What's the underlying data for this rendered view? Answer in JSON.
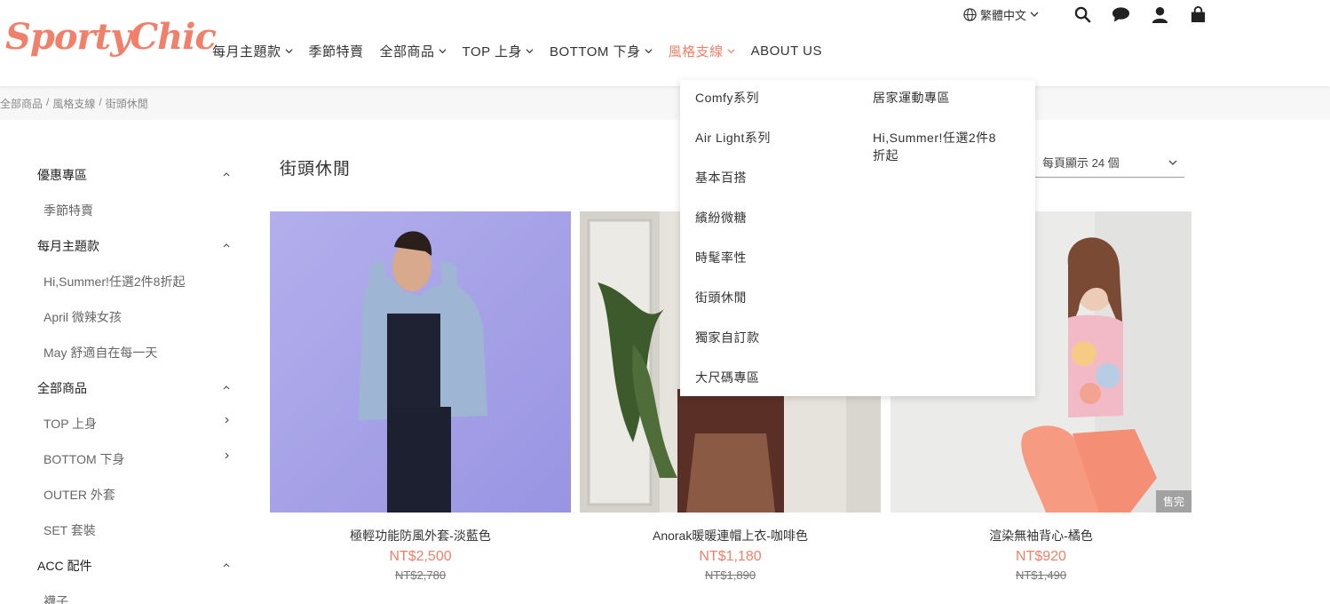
{
  "brand": {
    "logo": "SportyChic",
    "accent": "#f0806a"
  },
  "topbar": {
    "language": "繁體中文",
    "icons": [
      "globe-icon",
      "search-icon",
      "chat-icon",
      "user-icon",
      "cart-icon"
    ]
  },
  "nav": {
    "items": [
      {
        "label": "每月主題款",
        "caret": true
      },
      {
        "label": "季節特賣",
        "caret": false
      },
      {
        "label": "全部商品",
        "caret": true
      },
      {
        "label": "TOP 上身",
        "caret": true
      },
      {
        "label": "BOTTOM 下身",
        "caret": true
      },
      {
        "label": "風格支線",
        "caret": true,
        "active": true
      },
      {
        "label": "ABOUT US",
        "caret": false
      }
    ]
  },
  "breadcrumb": [
    "全部商品",
    "風格支線",
    "街頭休閒"
  ],
  "sidebar": {
    "items": [
      {
        "label": "優惠專區",
        "type": "cat",
        "toggle": "up"
      },
      {
        "label": "季節特賣",
        "type": "sub"
      },
      {
        "label": "每月主題款",
        "type": "cat",
        "toggle": "up"
      },
      {
        "label": "Hi,Summer!任選2件8折起",
        "type": "sub"
      },
      {
        "label": "April 微辣女孩",
        "type": "sub"
      },
      {
        "label": "May 舒適自在每一天",
        "type": "sub"
      },
      {
        "label": "全部商品",
        "type": "cat",
        "toggle": "up"
      },
      {
        "label": "TOP 上身",
        "type": "sub",
        "toggle": "right"
      },
      {
        "label": "BOTTOM 下身",
        "type": "sub",
        "toggle": "right"
      },
      {
        "label": "OUTER 外套",
        "type": "sub"
      },
      {
        "label": "SET 套裝",
        "type": "sub"
      },
      {
        "label": "ACC 配件",
        "type": "cat",
        "toggle": "up"
      },
      {
        "label": "襪子",
        "type": "sub"
      }
    ]
  },
  "main": {
    "title": "街頭休閒",
    "per_page": "每頁顯示 24 個"
  },
  "products": [
    {
      "name": "極輕功能防風外套-淡藍色",
      "price": "NT$2,500",
      "original": "NT$2,780",
      "sold_out": false
    },
    {
      "name": "Anorak暖暖連帽上衣-咖啡色",
      "price": "NT$1,180",
      "original": "NT$1,890",
      "sold_out": false
    },
    {
      "name": "渲染無袖背心-橘色",
      "price": "NT$920",
      "original": "NT$1,490",
      "sold_out": true,
      "sold_out_label": "售完"
    }
  ],
  "dropdown": {
    "left": [
      "Comfy系列",
      "Air Light系列",
      "基本百搭",
      "繽紛微糖",
      "時髦率性",
      "街頭休閒",
      "獨家自訂款",
      "大尺碼專區"
    ],
    "right": [
      "居家運動專區",
      "Hi,Summer!任選2件8\n折起"
    ]
  }
}
